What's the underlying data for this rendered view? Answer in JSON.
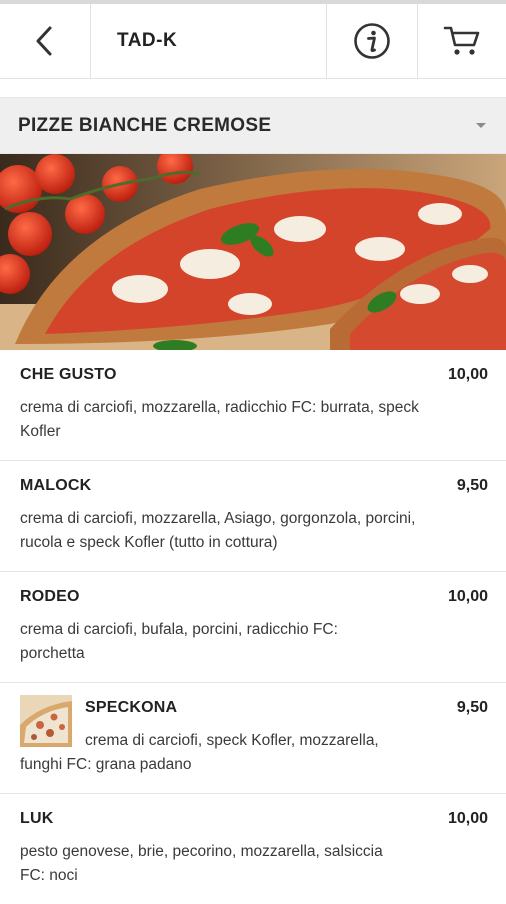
{
  "header": {
    "title": "TAD-K",
    "back_icon": "chevron-left-icon",
    "info_icon": "info-icon",
    "cart_icon": "cart-icon"
  },
  "category": {
    "label": "PIZZE BIANCHE CREMOSE"
  },
  "colors": {
    "divider": "#e2e2e2",
    "category_bg": "#efefef",
    "text": "#222222"
  },
  "menu": {
    "items": [
      {
        "name": "CHE GUSTO",
        "price": "10,00",
        "desc": "crema di carciofi, mozzarella, radicchio FC: burrata, speck Kofler"
      },
      {
        "name": "MALOCK",
        "price": "9,50",
        "desc": "crema di carciofi, mozzarella, Asiago, gorgonzola, porcini, rucola e speck Kofler (tutto in cottura)"
      },
      {
        "name": "RODEO",
        "price": "10,00",
        "desc": "crema di carciofi, bufala, porcini, radicchio FC: porchetta"
      },
      {
        "name": "SPECKONA",
        "price": "9,50",
        "desc_line1": "crema di carciofi, speck Kofler, mozzarella,",
        "desc_line2": "funghi FC: grana padano"
      },
      {
        "name": "LUK",
        "price": "10,00",
        "desc": "pesto genovese, brie, pecorino, mozzarella, salsiccia FC: noci"
      }
    ]
  }
}
